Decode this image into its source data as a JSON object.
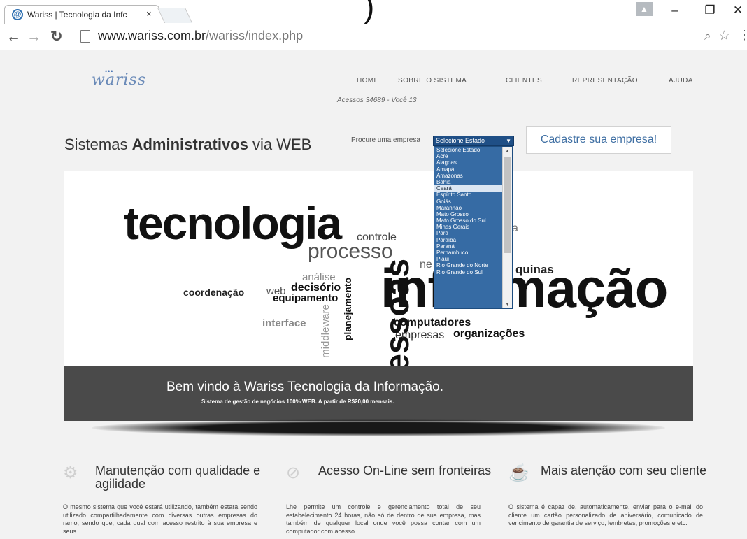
{
  "browser": {
    "tab_title": "Wariss | Tecnologia da Infc",
    "tab_close": "×",
    "window_glyph": ")",
    "url_domain": "www.wariss.com.br",
    "url_path": "/wariss/index.php"
  },
  "site": {
    "logo": "wariss",
    "nav": [
      "HOME",
      "SOBRE O SISTEMA",
      "CLIENTES",
      "REPRESENTAÇÃO",
      "AJUDA"
    ],
    "counter": "Acessos 34689 - Você 13",
    "headline_pre": "Sistemas ",
    "headline_bold": "Administrativos",
    "headline_post": " via WEB",
    "search_label": "Procure uma empresa",
    "select_value": "Selecione Estado",
    "register_button": "Cadastre sua empresa!"
  },
  "dropdown": {
    "options": [
      "Selecione Estado",
      "Acre",
      "Alagoas",
      "Amapá",
      "Amazonas",
      "Bahia",
      "Ceará",
      "Espírito Santo",
      "Goiás",
      "Maranhão",
      "Mato Grosso",
      "Mato Grosso do Sul",
      "Minas Gerais",
      "Pará",
      "Paraíba",
      "Paraná",
      "Pernambuco",
      "Piauí",
      "Rio Grande do Norte",
      "Rio Grande do Sul"
    ],
    "highlighted": "Ceará"
  },
  "hero": {
    "words": {
      "tecnologia": "tecnologia",
      "controle": "controle",
      "processo": "processo",
      "ne": "ne",
      "a": "a",
      "quinas": "quinas",
      "analise": "análise",
      "coordenacao": "coordenação",
      "web": "web",
      "decisorio": "decisório",
      "equipamento": "equipamento",
      "informacao": "informação",
      "interface": "interface",
      "middleware": "middleware",
      "planejamento": "planejamento",
      "pessoas": "pessoas",
      "computadores": "computadores",
      "empresas": "empresas",
      "organizacoes": "organizações"
    },
    "band_title": "Bem vindo à  Wariss Tecnologia da Informação.",
    "band_subtitle": "Sistema de gestão de negócios 100% WEB. A partir de R$20,00 mensais."
  },
  "features": [
    {
      "icon": "gears-icon",
      "title": "Manutenção com qualidade e agilidade",
      "text": "O mesmo sistema que você estará utilizando, também estarạ sendo utilizado compartilhadamente com diversas outras empresas do ramo, sendo que, cada qual com acesso restrito à sua empresa e seus"
    },
    {
      "icon": "compass-icon",
      "title": "Acesso On-Line sem fronteiras",
      "text": "Lhe permite um controle e gerenciamento total de seu estabelecimento 24 horas, não só de dentro de sua empresa, mas também de qualquer local onde você possa contar com um computador com acesso"
    },
    {
      "icon": "coffee-icon",
      "title": "Mais atenção com seu cliente",
      "text": "O sistema é capaz de, automaticamente, enviar para o e-mail do cliente um cartão personalizado de aniversário, comunicado de vencimento de garantia de serviço, lembretes, promoções e etc."
    }
  ]
}
